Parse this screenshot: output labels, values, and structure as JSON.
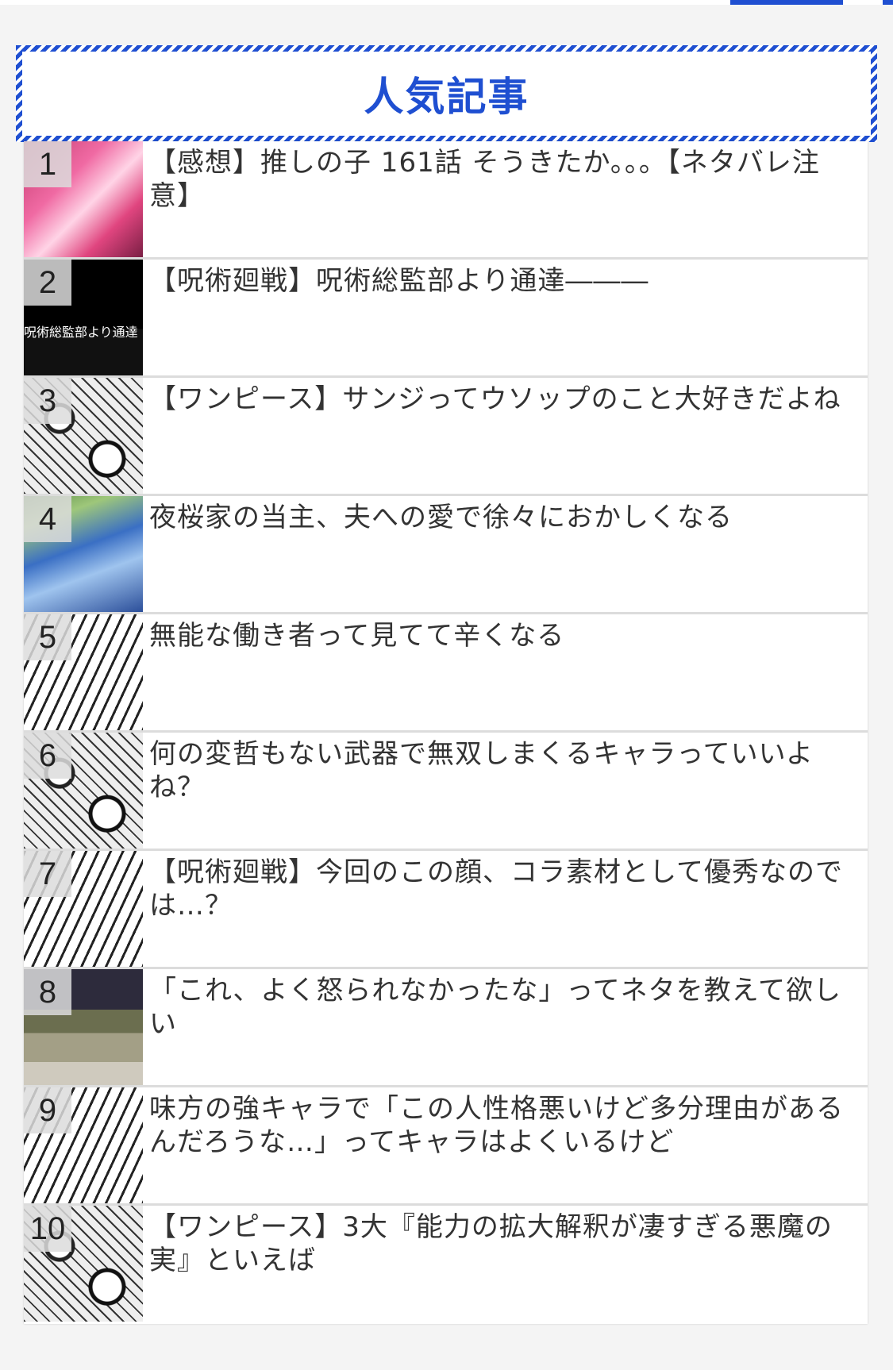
{
  "heading": {
    "title": "人気記事"
  },
  "articles": [
    {
      "rank": "1",
      "title": "【感想】推しの子 161話 そうきたか。。。【ネタバレ注意】",
      "thumb": "oshi-no-ko-thumbnail"
    },
    {
      "rank": "2",
      "title": "【呪術廻戦】呪術総監部より通達―――",
      "thumb": "jujutsu-notice-thumbnail",
      "thumb_caption": "呪術総監部より通達"
    },
    {
      "rank": "3",
      "title": "【ワンピース】サンジってウソップのこと大好きだよね",
      "thumb": "one-piece-manga-thumbnail"
    },
    {
      "rank": "4",
      "title": "夜桜家の当主、夫への愛で徐々におかしくなる",
      "thumb": "yozakura-thumbnail"
    },
    {
      "rank": "5",
      "title": "無能な働き者って見てて辛くなる",
      "thumb": "manga-face-thumbnail"
    },
    {
      "rank": "6",
      "title": "何の変哲もない武器で無双しまくるキャラっていいよね？",
      "thumb": "manga-weapon-thumbnail"
    },
    {
      "rank": "7",
      "title": "【呪術廻戦】今回のこの顔、コラ素材として優秀なのでは…？",
      "thumb": "jujutsu-face-thumbnail"
    },
    {
      "rank": "8",
      "title": "「これ、よく怒られなかったな」ってネタを教えて欲しい",
      "thumb": "anime-scene-thumbnail"
    },
    {
      "rank": "9",
      "title": "味方の強キャラで「この人性格悪いけど多分理由があるんだろうな…」ってキャラはよくいるけど",
      "thumb": "manga-mask-thumbnail"
    },
    {
      "rank": "10",
      "title": "【ワンピース】3大『能力の拡大解釈が凄すぎる悪魔の実』といえば",
      "thumb": "one-piece-panels-thumbnail"
    }
  ],
  "colors": {
    "accent": "#1f4fd1",
    "background": "#f4f4f4",
    "rank_badge": "#dcdcdc"
  }
}
